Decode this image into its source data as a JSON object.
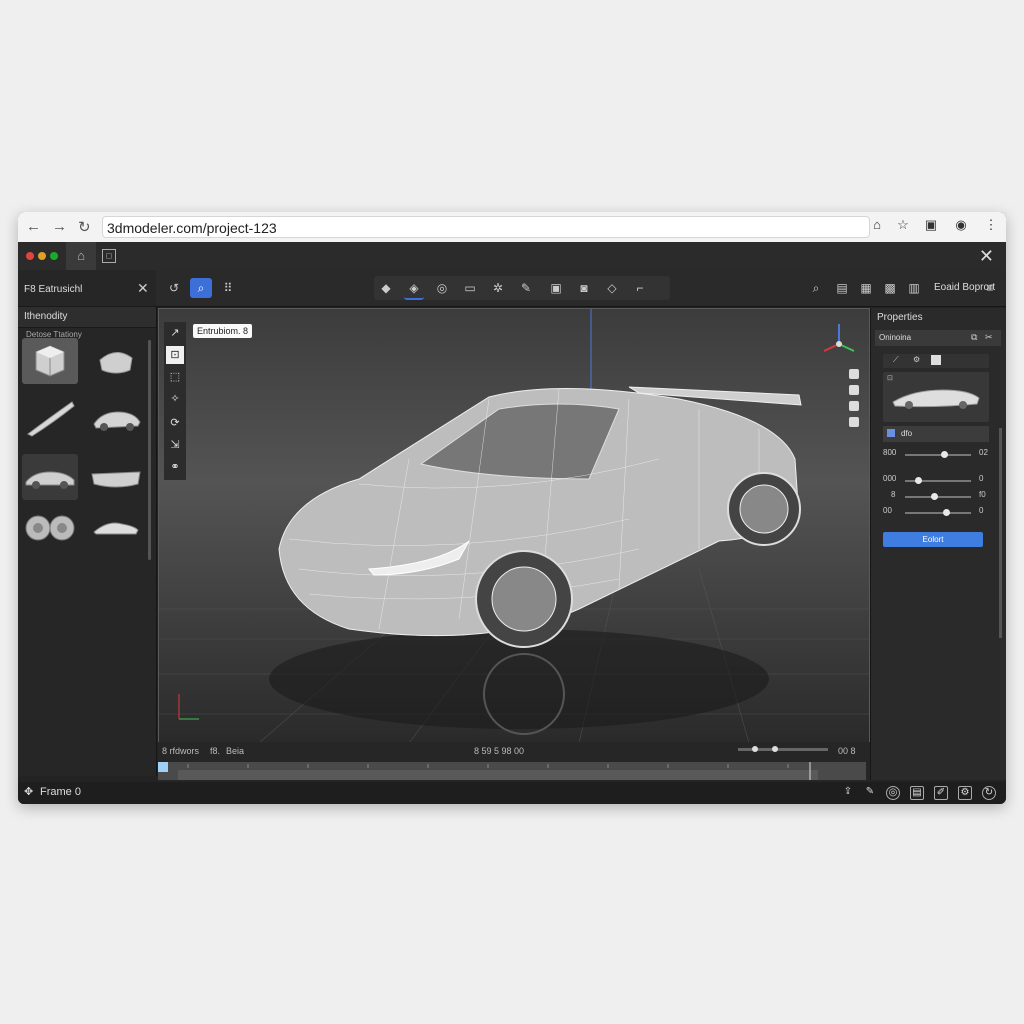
{
  "browser": {
    "url": "3dmodeler.com/project-123",
    "back_icon": "arrow-left-icon",
    "forward_icon": "arrow-right-icon",
    "reload_icon": "reload-icon"
  },
  "app_bar": {
    "dots": [
      "#e0443e",
      "#dea123",
      "#1aab29"
    ]
  },
  "left_panel": {
    "header": "F8 Eatrusichl",
    "tab": "Ithenodity",
    "section": "Detose Ttationy",
    "thumbnails": [
      "cube",
      "bumper",
      "blade",
      "car-top",
      "car-side",
      "front-bumper",
      "wheels",
      "spoiler-car"
    ]
  },
  "toolbar": {
    "right_label": "Eoaid Boprort"
  },
  "viewport": {
    "label": "Entrubiom. 8"
  },
  "timeline": {
    "left_text": "8 rfdwors",
    "mid_text_a": "f8.",
    "mid_text_b": "Beia",
    "center_text": "8 59 5 98 00",
    "right_text": "00 8"
  },
  "properties": {
    "title": "Properties",
    "subheader": "Oninoina",
    "field_label": "dfo",
    "sliders": [
      {
        "label": "800",
        "value": 0.55,
        "end": "02"
      },
      {
        "label": "000",
        "value": 0.2,
        "end": "0"
      },
      {
        "label": "8",
        "value": 0.45,
        "end": "f0"
      },
      {
        "label": "00",
        "value": 0.6,
        "end": "0"
      }
    ],
    "button": "Eolort"
  },
  "status": {
    "frame": "Frame 0"
  }
}
